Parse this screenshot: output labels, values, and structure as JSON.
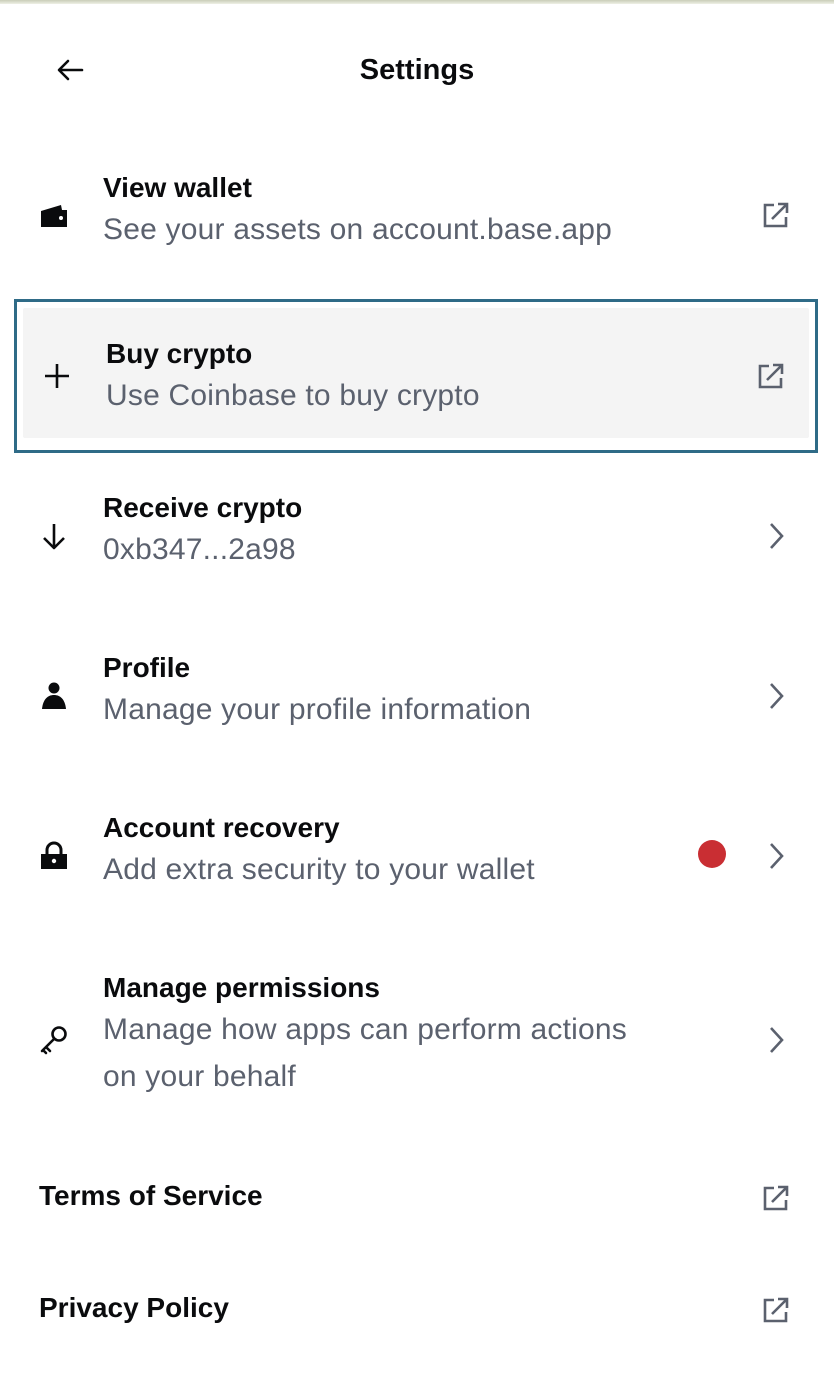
{
  "header": {
    "title": "Settings",
    "back_icon": "arrow-left-icon"
  },
  "items": [
    {
      "label": "View wallet",
      "sub": "See your assets on account.base.app",
      "icon": "wallet-icon",
      "trail": "external-link-icon"
    },
    {
      "label": "Buy crypto",
      "sub": "Use Coinbase to buy crypto",
      "icon": "plus-icon",
      "trail": "external-link-icon",
      "focused": true
    },
    {
      "label": "Receive crypto",
      "sub": "0xb347...2a98",
      "icon": "arrow-down-icon",
      "trail": "chevron-right-icon"
    },
    {
      "label": "Profile",
      "sub": "Manage your profile information",
      "icon": "person-icon",
      "trail": "chevron-right-icon"
    },
    {
      "label": "Account recovery",
      "sub": "Add extra security to your wallet",
      "icon": "lock-icon",
      "trail": "chevron-right-icon",
      "badge_color": "#c92e33"
    },
    {
      "label": "Manage permissions",
      "sub_line1": "Manage how apps can perform actions",
      "sub_line2": "on your behalf",
      "icon": "key-icon",
      "trail": "chevron-right-icon"
    }
  ],
  "links": [
    {
      "label": "Terms of Service",
      "trail": "external-link-icon"
    },
    {
      "label": "Privacy Policy",
      "trail": "external-link-icon"
    }
  ],
  "colors": {
    "focus_border": "#2f6b87",
    "focused_bg": "#f4f4f4",
    "text_primary": "#0a0b0d",
    "text_secondary": "#5b616e",
    "badge": "#c92e33"
  }
}
